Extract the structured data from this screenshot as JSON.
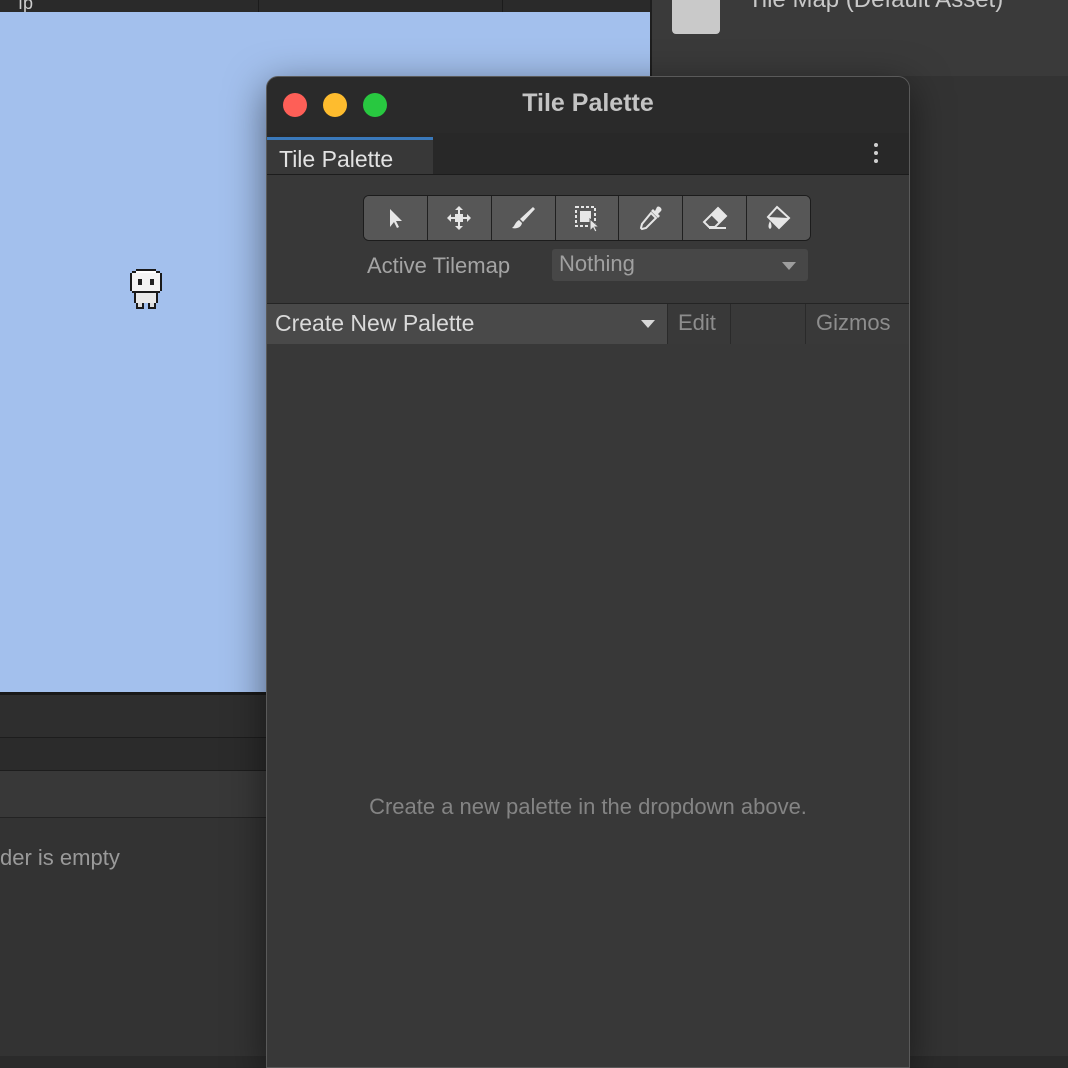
{
  "background_editor": {
    "top_text": "ıp",
    "folder_empty_text": "der is empty"
  },
  "inspector": {
    "asset_title": "Tile Map (Default Asset)"
  },
  "window": {
    "title": "Tile Palette",
    "tab_label": "Tile Palette",
    "tools": [
      {
        "name": "select-tool",
        "icon": "arrow-icon"
      },
      {
        "name": "move-tool",
        "icon": "move-icon"
      },
      {
        "name": "paint-tool",
        "icon": "brush-icon"
      },
      {
        "name": "box-fill-tool",
        "icon": "box-select-icon"
      },
      {
        "name": "pick-tool",
        "icon": "eyedropper-icon"
      },
      {
        "name": "erase-tool",
        "icon": "eraser-icon"
      },
      {
        "name": "flood-fill-tool",
        "icon": "paint-bucket-icon"
      }
    ],
    "active_tilemap_label": "Active Tilemap",
    "active_tilemap_value": "Nothing",
    "palette_dropdown": "Create New Palette",
    "edit_label": "Edit",
    "gizmos_label": "Gizmos",
    "empty_message": "Create a new palette in the dropdown above."
  },
  "colors": {
    "scene_bg": "#a3c0ed",
    "tab_accent": "#3a79bb",
    "close": "#fe5f57",
    "minimize": "#febc2e",
    "zoom": "#28c840"
  }
}
